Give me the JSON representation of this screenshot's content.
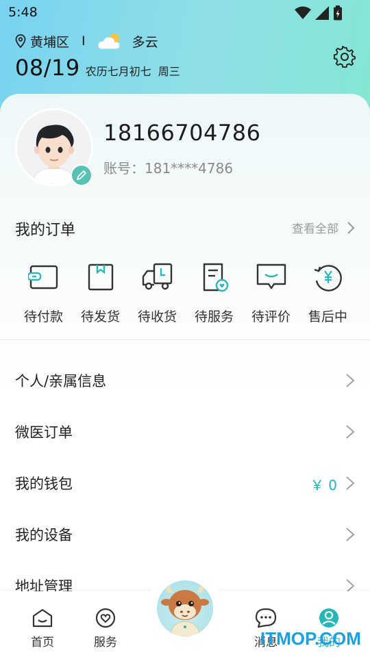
{
  "status_bar": {
    "time": "5:48"
  },
  "header": {
    "location": "黄埔区",
    "separator": "I",
    "weather": "多云",
    "date": "08/19",
    "lunar": "农历七月初七",
    "weekday": "周三"
  },
  "profile": {
    "phone": "18166704786",
    "account": "账号：181****4786"
  },
  "orders": {
    "title": "我的订单",
    "view_all": "查看全部",
    "items": [
      {
        "label": "待付款",
        "icon": "wallet-card-icon"
      },
      {
        "label": "待发货",
        "icon": "box-icon"
      },
      {
        "label": "待收货",
        "icon": "truck-icon"
      },
      {
        "label": "待服务",
        "icon": "service-doc-icon"
      },
      {
        "label": "待评价",
        "icon": "comment-icon"
      },
      {
        "label": "售后中",
        "icon": "refund-icon"
      }
    ]
  },
  "menu": [
    {
      "label": "个人/亲属信息",
      "value": ""
    },
    {
      "label": "微医订单",
      "value": ""
    },
    {
      "label": "我的钱包",
      "value": "￥ 0"
    },
    {
      "label": "我的设备",
      "value": ""
    },
    {
      "label": "地址管理",
      "value": ""
    }
  ],
  "tabs": [
    {
      "label": "首页",
      "icon": "home-icon"
    },
    {
      "label": "服务",
      "icon": "heart-icon"
    },
    {
      "label": "消息",
      "icon": "chat-icon"
    },
    {
      "label": "我的",
      "icon": "profile-icon",
      "active": true
    }
  ],
  "watermark": "ITMOP.COM",
  "colors": {
    "accent": "#26b8b8",
    "wallet_value": "#1fb5b9"
  }
}
